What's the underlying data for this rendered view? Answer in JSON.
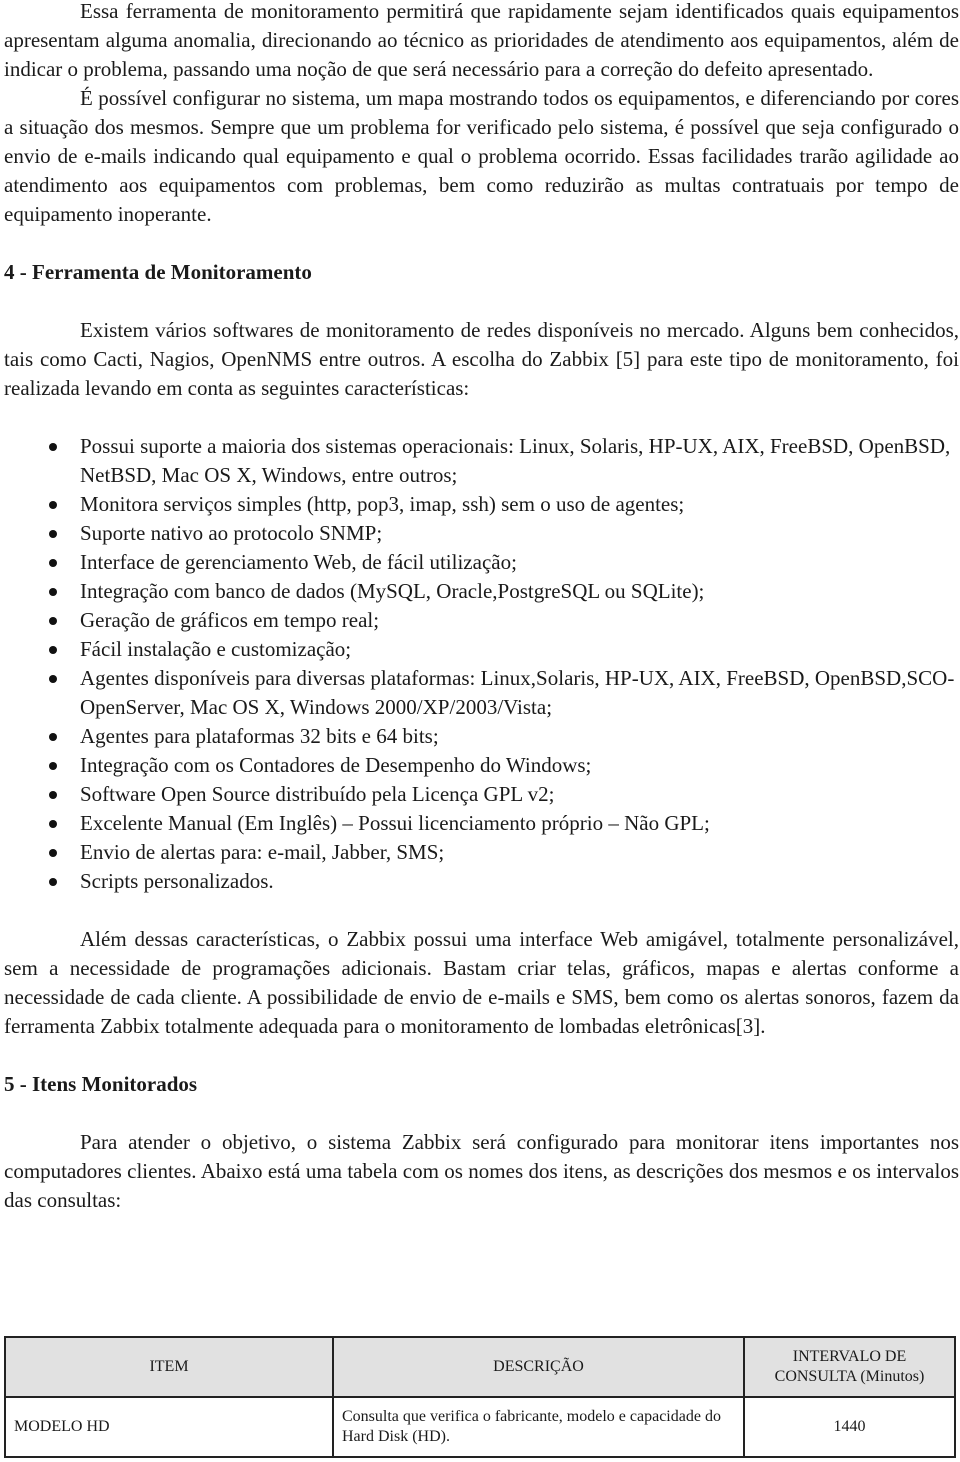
{
  "document": {
    "paragraphs": {
      "p1": "Essa ferramenta de monitoramento permitirá que rapidamente sejam identificados quais equipamentos apresentam alguma anomalia, direcionando ao técnico as prioridades de atendimento aos equipamentos, além de indicar o problema, passando uma noção de que será necessário para a correção do defeito apresentado.",
      "p2": "É possível configurar no sistema, um mapa mostrando todos os equipamentos, e diferenciando por cores a situação dos mesmos. Sempre que um problema for verificado pelo sistema, é possível que seja configurado o envio de e-mails indicando qual equipamento e qual o problema ocorrido. Essas facilidades trarão agilidade ao atendimento aos equipamentos com problemas, bem como reduzirão as multas contratuais por tempo de equipamento inoperante.",
      "p3": "Existem vários softwares de monitoramento de redes disponíveis no mercado. Alguns bem conhecidos, tais como Cacti, Nagios, OpenNMS entre outros. A escolha do Zabbix [5] para este tipo de monitoramento, foi realizada levando em conta as seguintes características:",
      "p4": "Além dessas características, o Zabbix possui uma interface Web amigável, totalmente personalizável, sem a necessidade de programações adicionais. Bastam criar telas, gráficos, mapas e alertas conforme a necessidade de cada cliente. A possibilidade de envio de e-mails e SMS, bem como os alertas sonoros, fazem da ferramenta Zabbix totalmente adequada para o monitoramento de lombadas eletrônicas[3].",
      "p5": "Para atender o objetivo, o sistema Zabbix será configurado para monitorar itens importantes nos computadores clientes. Abaixo está uma tabela com os nomes dos itens, as descrições dos mesmos e os intervalos das consultas:"
    },
    "headings": {
      "section4": "4 - Ferramenta de Monitoramento",
      "section5": "5 - Itens Monitorados"
    },
    "features": [
      "Possui suporte a maioria dos sistemas operacionais: Linux, Solaris, HP-UX, AIX, FreeBSD, OpenBSD, NetBSD, Mac OS X, Windows, entre outros;",
      "Monitora serviços simples (http, pop3, imap, ssh) sem o uso de agentes;",
      "Suporte nativo ao protocolo SNMP;",
      "Interface de gerenciamento Web, de fácil utilização;",
      "Integração com banco de dados (MySQL, Oracle,PostgreSQL ou SQLite);",
      "Geração de gráficos em tempo real;",
      "Fácil instalação e customização;",
      "Agentes disponíveis para diversas plataformas: Linux,Solaris, HP-UX, AIX, FreeBSD, OpenBSD,SCO-OpenServer, Mac OS X, Windows 2000/XP/2003/Vista;",
      "Agentes para plataformas 32 bits e 64 bits;",
      "Integração com os Contadores de Desempenho do Windows;",
      "Software Open Source distribuído pela Licença GPL v2;",
      "Excelente Manual (Em Inglês) – Possui licenciamento próprio – Não GPL;",
      "Envio de alertas para: e-mail, Jabber, SMS;",
      "Scripts personalizados."
    ],
    "table": {
      "headers": [
        "ITEM",
        "DESCRIÇÃO",
        "INTERVALO DE CONSULTA (Minutos)"
      ],
      "rows": [
        [
          "MODELO HD",
          "Consulta que verifica o fabricante, modelo e capacidade do Hard Disk (HD).",
          "1440"
        ]
      ],
      "header_bg": "#e1e1e1"
    }
  }
}
